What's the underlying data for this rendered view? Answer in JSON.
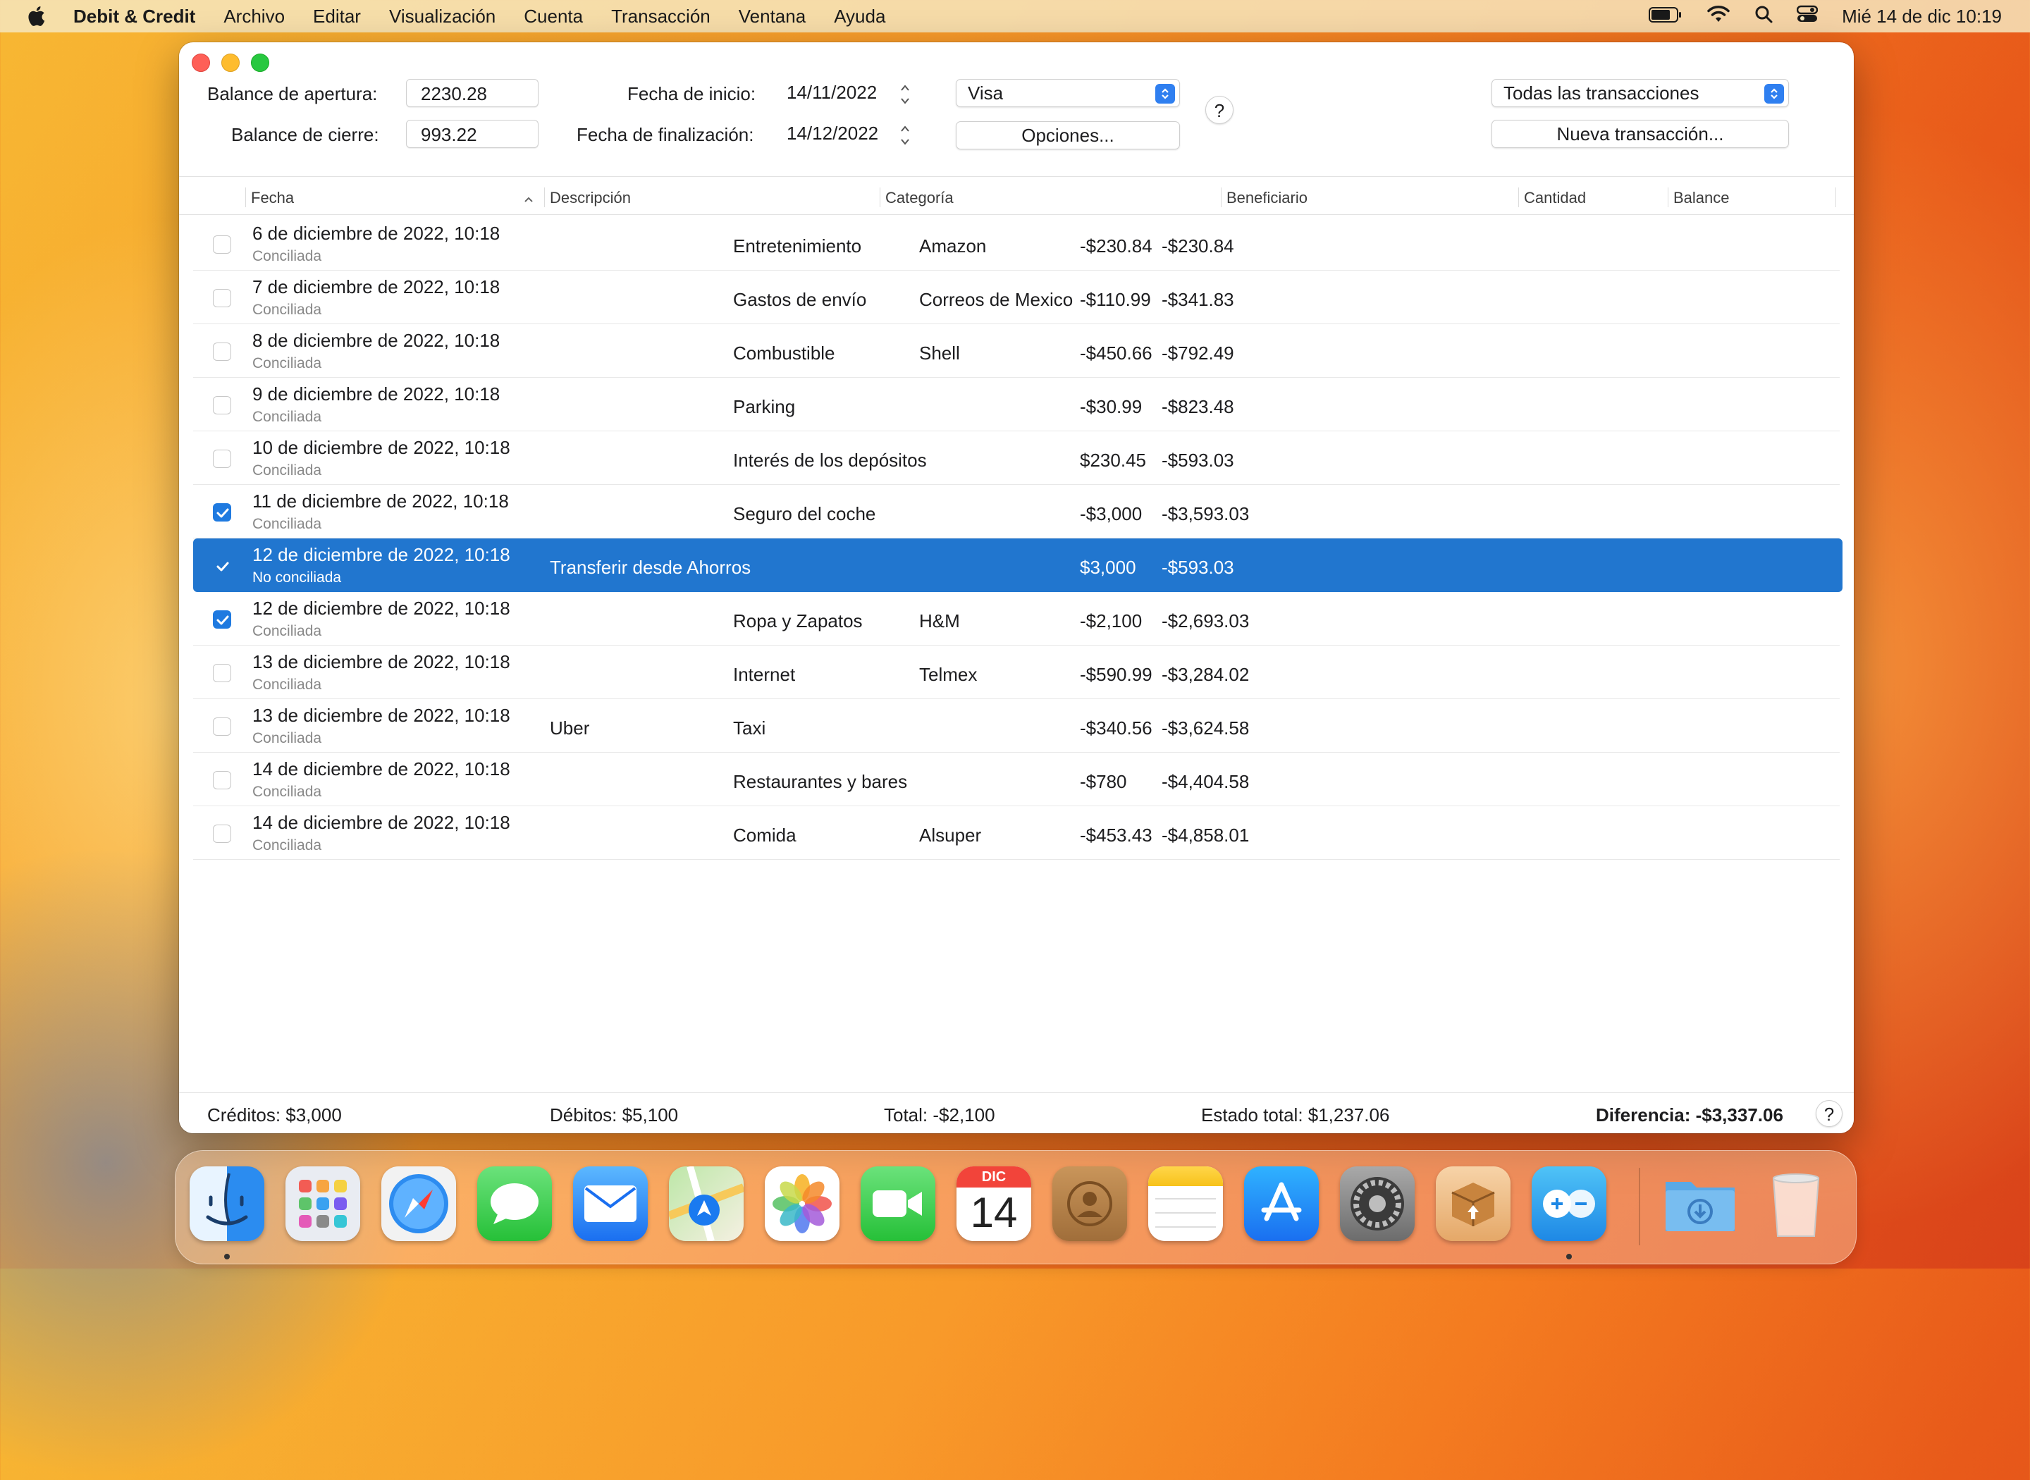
{
  "menubar": {
    "app_name": "Debit & Credit",
    "items": [
      "Archivo",
      "Editar",
      "Visualización",
      "Cuenta",
      "Transacción",
      "Ventana",
      "Ayuda"
    ],
    "datetime": "Mié 14 de dic  10:19"
  },
  "toolbar": {
    "opening_balance_label": "Balance de apertura:",
    "opening_balance_value": "2230.28",
    "closing_balance_label": "Balance de cierre:",
    "closing_balance_value": "993.22",
    "start_date_label": "Fecha de inicio:",
    "start_date_value": "14/11/2022",
    "end_date_label": "Fecha de finalización:",
    "end_date_value": "14/12/2022",
    "account_select": "Visa",
    "options_button": "Opciones...",
    "help_button": "?",
    "filter_select": "Todas las transacciones",
    "new_transaction_button": "Nueva transacción..."
  },
  "table": {
    "columns": [
      "Fecha",
      "Descripción",
      "Categoría",
      "Beneficiario",
      "Cantidad",
      "Balance"
    ],
    "rows": [
      {
        "date": "6 de diciembre de 2022, 10:18",
        "status": "Conciliada",
        "checked": false,
        "description": "",
        "category": "Entretenimiento",
        "payee": "Amazon",
        "amount": "-$230.84",
        "balance": "-$230.84"
      },
      {
        "date": "7 de diciembre de 2022, 10:18",
        "status": "Conciliada",
        "checked": false,
        "description": "",
        "category": "Gastos de envío",
        "payee": "Correos de Mexico",
        "amount": "-$110.99",
        "balance": "-$341.83"
      },
      {
        "date": "8 de diciembre de 2022, 10:18",
        "status": "Conciliada",
        "checked": false,
        "description": "",
        "category": "Combustible",
        "payee": "Shell",
        "amount": "-$450.66",
        "balance": "-$792.49"
      },
      {
        "date": "9 de diciembre de 2022, 10:18",
        "status": "Conciliada",
        "checked": false,
        "description": "",
        "category": "Parking",
        "payee": "",
        "amount": "-$30.99",
        "balance": "-$823.48"
      },
      {
        "date": "10 de diciembre de 2022, 10:18",
        "status": "Conciliada",
        "checked": false,
        "description": "",
        "category": "Interés de los depósitos",
        "payee": "",
        "amount": "$230.45",
        "balance": "-$593.03"
      },
      {
        "date": "11 de diciembre de 2022, 10:18",
        "status": "Conciliada",
        "checked": true,
        "description": "",
        "category": "Seguro del coche",
        "payee": "",
        "amount": "-$3,000",
        "balance": "-$3,593.03"
      },
      {
        "date": "12 de diciembre de 2022, 10:18",
        "status": "No conciliada",
        "checked": true,
        "selected": true,
        "description": "Transferir desde Ahorros",
        "category": "",
        "payee": "",
        "amount": "$3,000",
        "balance": "-$593.03"
      },
      {
        "date": "12 de diciembre de 2022, 10:18",
        "status": "Conciliada",
        "checked": true,
        "description": "",
        "category": "Ropa y Zapatos",
        "payee": "H&M",
        "amount": "-$2,100",
        "balance": "-$2,693.03"
      },
      {
        "date": "13 de diciembre de 2022, 10:18",
        "status": "Conciliada",
        "checked": false,
        "description": "",
        "category": "Internet",
        "payee": "Telmex",
        "amount": "-$590.99",
        "balance": "-$3,284.02"
      },
      {
        "date": "13 de diciembre de 2022, 10:18",
        "status": "Conciliada",
        "checked": false,
        "description": "Uber",
        "category": "Taxi",
        "payee": "",
        "amount": "-$340.56",
        "balance": "-$3,624.58"
      },
      {
        "date": "14 de diciembre de 2022, 10:18",
        "status": "Conciliada",
        "checked": false,
        "description": "",
        "category": "Restaurantes y bares",
        "payee": "",
        "amount": "-$780",
        "balance": "-$4,404.58"
      },
      {
        "date": "14 de diciembre de 2022, 10:18",
        "status": "Conciliada",
        "checked": false,
        "description": "",
        "category": "Comida",
        "payee": "Alsuper",
        "amount": "-$453.43",
        "balance": "-$4,858.01"
      }
    ]
  },
  "footer": {
    "credits": "Créditos: $3,000",
    "debits": "Débitos: $5,100",
    "total": "Total: -$2,100",
    "statement_total": "Estado total: $1,237.06",
    "difference": "Diferencia: -$3,337.06",
    "help": "?"
  },
  "dock": {
    "calendar_month": "DIC",
    "calendar_day": "14",
    "apps": [
      "finder-icon",
      "launchpad-icon",
      "safari-icon",
      "messages-icon",
      "mail-icon",
      "maps-icon",
      "photos-icon",
      "facetime-icon",
      "calendar-icon",
      "contacts-icon",
      "notes-icon",
      "app-store-icon",
      "system-settings-icon",
      "package-icon",
      "debit-credit-icon",
      "downloads-folder-icon",
      "trash-icon"
    ]
  },
  "colors": {
    "selection": "#2176cf",
    "accent": "#1f7ae0"
  }
}
